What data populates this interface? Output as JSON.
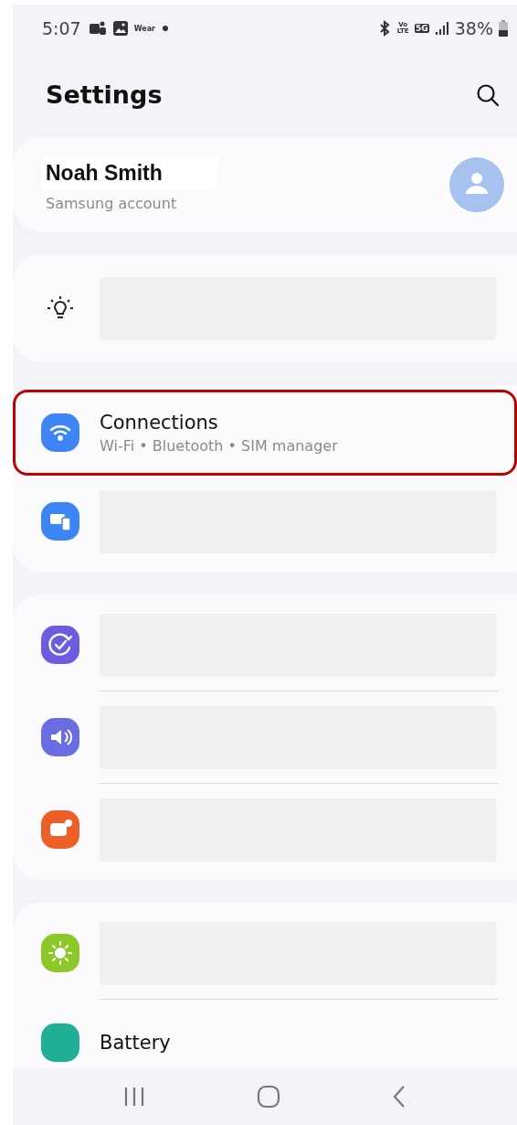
{
  "status_bar": {
    "time": "5:07",
    "wear_label": "Wear",
    "volte_label": "Vo LTE",
    "network_label": "5G",
    "battery_percent": "38%"
  },
  "header": {
    "title": "Settings"
  },
  "profile": {
    "name": "Noah Smith",
    "subtitle": "Samsung account"
  },
  "groups": [
    {
      "items": [
        {
          "kind": "redacted",
          "highlighted": false
        }
      ]
    },
    {
      "items": [
        {
          "kind": "entry",
          "color": "#3d85f4",
          "title": "Connections",
          "subtitle": "Wi-Fi • Bluetooth • SIM manager",
          "highlighted": true
        },
        {
          "kind": "redacted",
          "color": "#3d85f4",
          "highlighted": false
        }
      ]
    },
    {
      "items": [
        {
          "kind": "redacted",
          "color": "#6b5ce0",
          "highlighted": false
        },
        {
          "kind": "redacted",
          "color": "#6a6de2",
          "highlighted": false
        },
        {
          "kind": "redacted",
          "color": "#ec5f26",
          "highlighted": false
        }
      ]
    },
    {
      "items": [
        {
          "kind": "redacted",
          "color": "#8cc928",
          "highlighted": false
        },
        {
          "kind": "entry",
          "color": "#1fae96",
          "title": "Battery",
          "highlighted": false
        }
      ]
    }
  ]
}
